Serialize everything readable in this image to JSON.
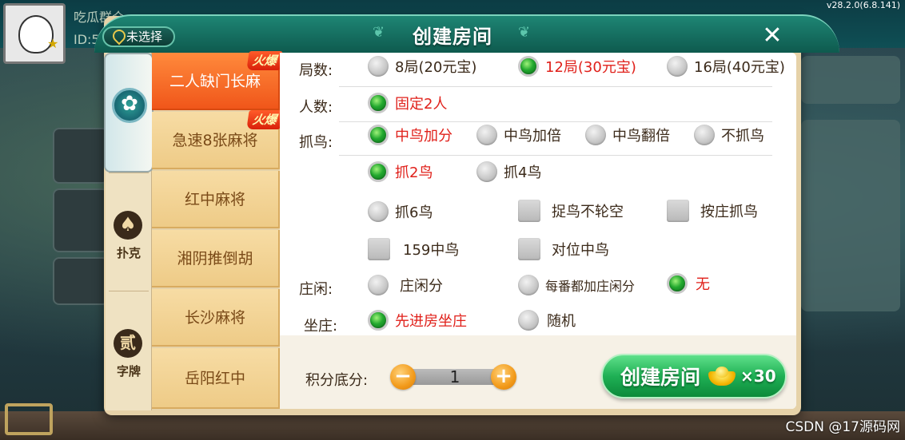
{
  "app": {
    "version": "v28.2.0(6.8.141)",
    "player_name": "吃瓜群众",
    "player_id_prefix": "ID:5",
    "location": "未选择",
    "watermark": "CSDN @17源码网"
  },
  "dialog": {
    "title": "创建房间",
    "close_symbol": "✕"
  },
  "rail": {
    "tabs": [
      {
        "label": ""
      },
      {
        "label": "扑克",
        "icon_char": "♠"
      },
      {
        "label": "字牌",
        "icon_char": "贰"
      }
    ]
  },
  "games": [
    {
      "label": "二人缺门长麻",
      "badge": "火爆"
    },
    {
      "label": "急速8张麻将",
      "badge": "火爆"
    },
    {
      "label": "红中麻将"
    },
    {
      "label": "湘阴推倒胡"
    },
    {
      "label": "长沙麻将"
    },
    {
      "label": "岳阳红中"
    }
  ],
  "options": {
    "rounds": {
      "label": "局数:",
      "items": [
        "8局(20元宝)",
        "12局(30元宝)",
        "16局(40元宝)"
      ],
      "selected": 1
    },
    "players": {
      "label": "人数:",
      "items": [
        "固定2人"
      ],
      "selected": 0
    },
    "birds": {
      "label": "抓鸟:",
      "mode_items": [
        "中鸟加分",
        "中鸟加倍",
        "中鸟翻倍",
        "不抓鸟"
      ],
      "count_items": [
        "抓2鸟",
        "抓4鸟",
        "抓6鸟"
      ],
      "extra_checkboxes": [
        "捉鸟不轮空",
        "按庄抓鸟",
        "159中鸟",
        "对位中鸟"
      ]
    },
    "dealer_score": {
      "label": "庄闲:",
      "items": [
        "庄闲分",
        "每番都加庄闲分",
        "无"
      ],
      "selected": 2
    },
    "seat": {
      "label": "坐庄:",
      "items": [
        "先进房坐庄",
        "随机"
      ],
      "selected": 0
    }
  },
  "footer": {
    "score_label": "积分底分:",
    "score_value": "1",
    "minus": "−",
    "plus": "+",
    "create_label": "创建房间",
    "cost": "×30"
  },
  "colors": {
    "header_green": "#0e5a4e",
    "selected_text": "#e0201a",
    "active_game": "#f0561a",
    "create_green": "#1fb055"
  }
}
